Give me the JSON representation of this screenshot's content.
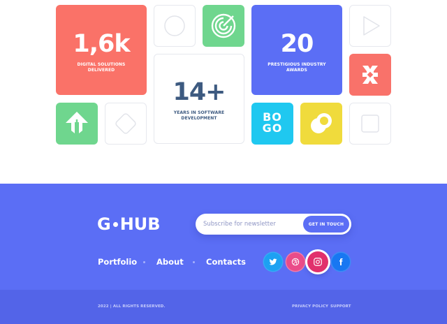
{
  "stats": {
    "solutions": {
      "value": "1,6k",
      "caption_line1": "DIGITAL SOLUTIONS",
      "caption_line2": "DELIVERED",
      "color": "#fa7268"
    },
    "experience": {
      "value": "14+",
      "caption_line1": "YEARS IN SOFTWARE",
      "caption_line2": "DEVELOPMENT",
      "color": "#3d5a80"
    },
    "awards": {
      "value": "20",
      "caption_line1": "PRESTIGIOUS INDUSTRY",
      "caption_line2": "AWARDS",
      "color": "#5b6ef5"
    }
  },
  "partner_tiles": [
    {
      "icon": "circle-outline-icon"
    },
    {
      "icon": "target-logo-icon",
      "color": "#6fd68e"
    },
    {
      "icon": "play-outline-icon"
    },
    {
      "icon": "x-logo-icon",
      "color": "#f9726a"
    },
    {
      "icon": "arrow-up-logo-icon",
      "color": "#6fd68e"
    },
    {
      "icon": "diamond-outline-icon"
    },
    {
      "icon": "bogo-logo-icon",
      "color": "#1fc8f0",
      "text_line1": "BO",
      "text_line2": "GO"
    },
    {
      "icon": "rings-logo-icon",
      "color": "#f0db3c"
    },
    {
      "icon": "square-outline-icon"
    }
  ],
  "footer": {
    "logo_left": "G",
    "logo_right": "HUB",
    "newsletter_placeholder": "Subscribe for newsletter",
    "newsletter_button": "GET IN TOUCH",
    "nav": [
      "Portfolio",
      "About",
      "Contacts"
    ],
    "social": [
      {
        "icon": "twitter-icon",
        "color": "#1da1f2"
      },
      {
        "icon": "dribbble-icon",
        "color": "#ea4c89"
      },
      {
        "icon": "instagram-icon",
        "color": "#e1306c"
      },
      {
        "icon": "facebook-icon",
        "color": "#1877f2"
      }
    ],
    "copyright": "2022 | ALL RIGHTS RESERVED.",
    "privacy": "PRIVACY POLICY",
    "support": "SUPPORT",
    "colors": {
      "footer_bg": "#5b6ef5",
      "footer_bottom_bg": "#5364e8"
    }
  }
}
